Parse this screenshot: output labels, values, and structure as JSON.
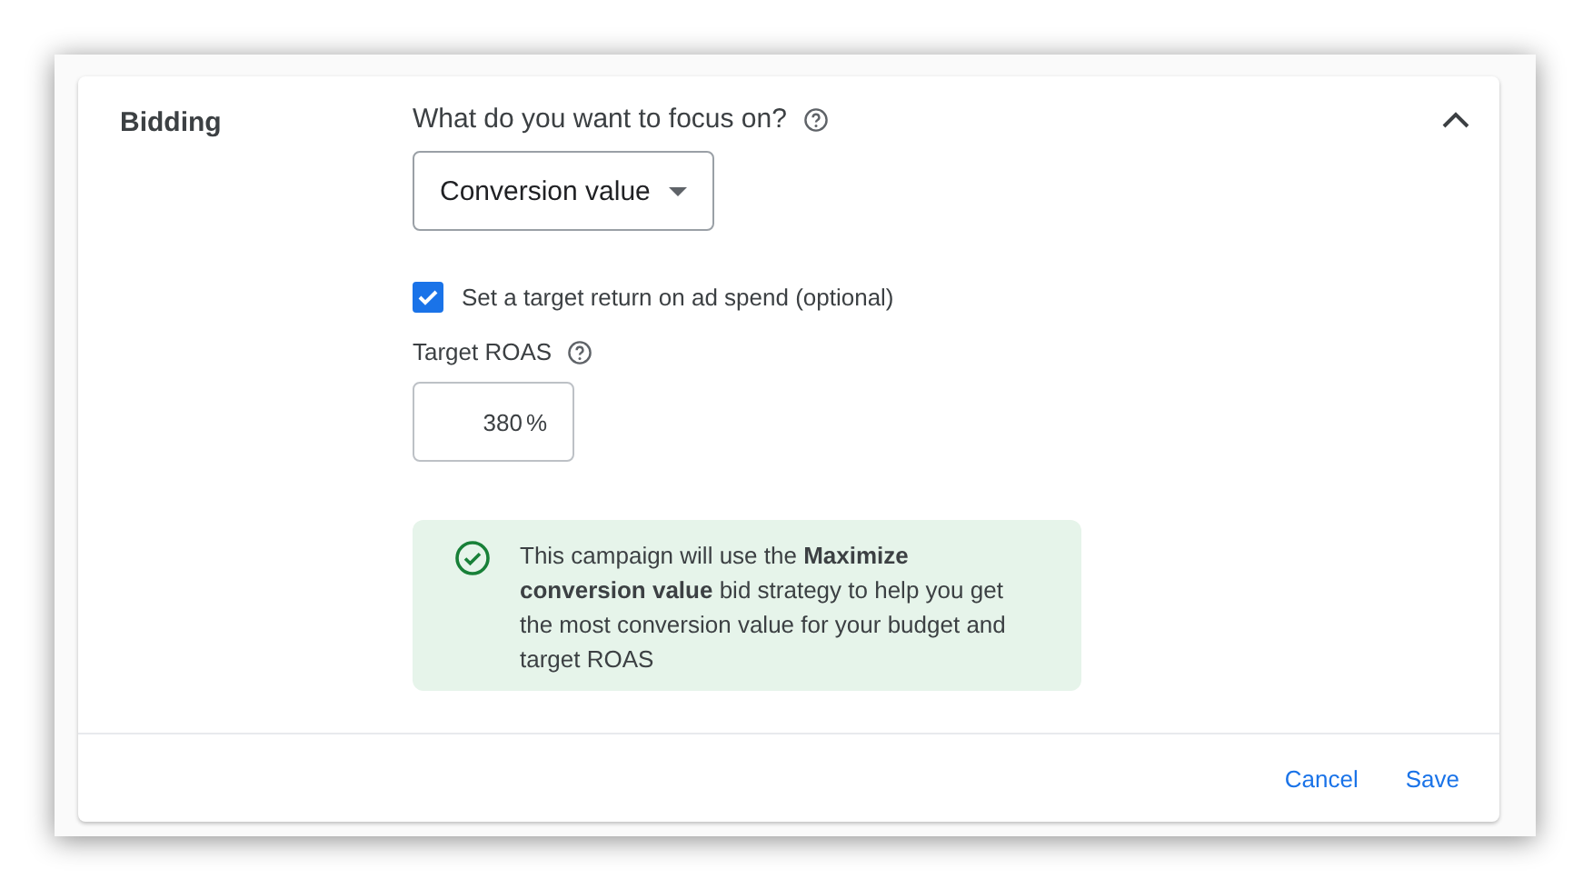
{
  "section": {
    "title": "Bidding",
    "expanded": true
  },
  "focus": {
    "label": "What do you want to focus on?",
    "value": "Conversion value"
  },
  "target_option": {
    "label": "Set a target return on ad spend (optional)",
    "checked": true
  },
  "target_roas": {
    "label": "Target ROAS",
    "value": "380",
    "suffix": "%"
  },
  "notice": {
    "text": "This campaign will use the **Maximize conversion value** bid strategy to help you get the most conversion value for your budget and target ROAS"
  },
  "buttons": [
    "Cancel",
    "Save"
  ]
}
